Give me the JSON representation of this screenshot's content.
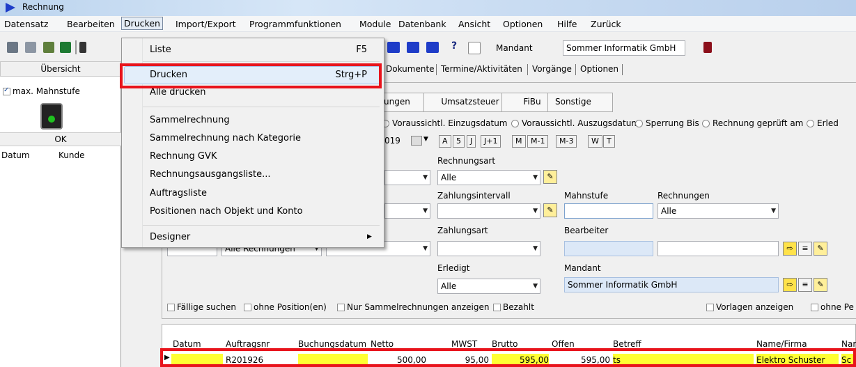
{
  "window": {
    "title": "Rechnung"
  },
  "menubar": [
    "Datensatz",
    "Bearbeiten",
    "Drucken",
    "Import/Export",
    "Programmfunktionen",
    "Module",
    "Datenbank",
    "Ansicht",
    "Optionen",
    "Hilfe",
    "Zurück"
  ],
  "toolbar": {
    "mandant_label": "Mandant",
    "mandant_value": "Sommer Informatik GmbH"
  },
  "left_panel": {
    "header": "Übersicht",
    "checkbox": "max. Mahnstufe",
    "ok": "OK",
    "col_datum": "Datum",
    "col_kunde": "Kunde"
  },
  "tabs": [
    "Dokumente",
    "Termine/Aktivitäten",
    "Vorgänge",
    "Optionen"
  ],
  "subtabs": [
    "ungen",
    "Umsatzsteuer",
    "FiBu",
    "Sonstige"
  ],
  "radios": [
    "Voraussichtl. Einzugsdatum",
    "Voraussichtl. Auszugsdatum",
    "Sperrung Bis",
    "Rechnung geprüft am",
    "Erled"
  ],
  "date_fragment": "019",
  "shortcut_buttons": [
    "A",
    "5",
    "J",
    "J+1",
    "M",
    "M-1",
    "M-3",
    "W",
    "T"
  ],
  "filters": {
    "rechnungsart_label": "Rechnungsart",
    "rechnungsart_value": "Alle",
    "zahlungsintervall_label": "Zahlungsintervall",
    "mahnstufe_label": "Mahnstufe",
    "rechnungen_label": "Rechnungen",
    "rechnungen_value": "Alle",
    "zahlungsart_label": "Zahlungsart",
    "bearbeiter_label": "Bearbeiter",
    "erledigt_label": "Erledigt",
    "erledigt_value": "Alle",
    "mandant_label": "Mandant",
    "mandant_value": "Sommer Informatik GmbH",
    "hidden_value": "Alle Rechnungen"
  },
  "checkboxes": [
    "Fällige suchen",
    "ohne Position(en)",
    "Nur Sammelrechnungen anzeigen",
    "Bezahlt",
    "Vorlagen anzeigen",
    "ohne Pe"
  ],
  "grid": {
    "headers": [
      "Datum",
      "Auftragsnr",
      "Buchungsdatum",
      "Netto",
      "MWST",
      "Brutto",
      "Offen",
      "Betreff",
      "Name/Firma",
      "Nar"
    ],
    "row": {
      "auftragsnr": "R201926",
      "netto": "500,00",
      "mwst": "95,00",
      "brutto": "595,00",
      "offen": "595,00",
      "betreff": "ts",
      "name": "Elektro Schuster",
      "extra": "Sc"
    }
  },
  "dropdown": {
    "items": [
      {
        "label": "Liste",
        "shortcut": "F5"
      },
      {
        "label": "Drucken",
        "shortcut": "Strg+P"
      },
      {
        "label": "Alle drucken",
        "shortcut": ""
      },
      {
        "label": "Sammelrechnung",
        "shortcut": ""
      },
      {
        "label": "Sammelrechnung nach Kategorie",
        "shortcut": ""
      },
      {
        "label": "Rechnung GVK",
        "shortcut": ""
      },
      {
        "label": "Rechnungsausgangsliste...",
        "shortcut": ""
      },
      {
        "label": "Auftragsliste",
        "shortcut": ""
      },
      {
        "label": "Positionen nach Objekt und Konto",
        "shortcut": ""
      },
      {
        "label": "Designer",
        "shortcut": ""
      }
    ]
  },
  "colors": {
    "highlight_red": "#e8141c",
    "yellow": "#ffff33",
    "blue_field": "#dce8f7"
  }
}
